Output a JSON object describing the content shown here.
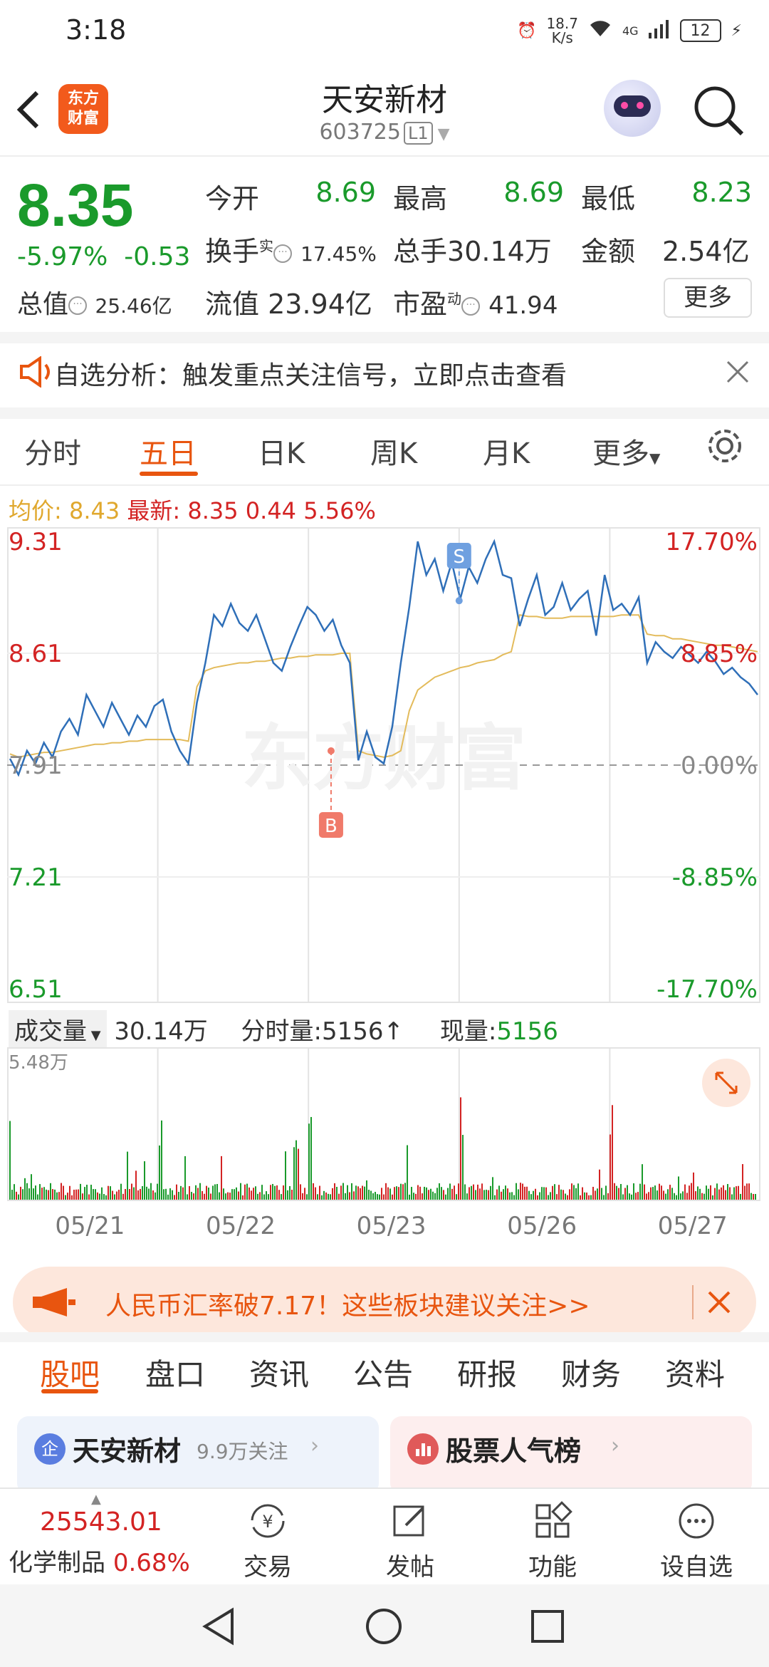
{
  "status_bar": {
    "time": "3:18",
    "net_speed_value": "18.7",
    "net_speed_unit": "K/s",
    "network": "4G",
    "battery": "12"
  },
  "header": {
    "logo_line1": "东方",
    "logo_line2": "财富",
    "title": "天安新材",
    "code": "603725",
    "level_badge": "L1"
  },
  "quote": {
    "price": "8.35",
    "change_pct": "-5.97%",
    "change_amt": "-0.53",
    "open_label": "今开",
    "open": "8.69",
    "high_label": "最高",
    "high": "8.69",
    "low_label": "最低",
    "low": "8.23",
    "turnover_label": "换手",
    "turnover_sup": "实",
    "turnover": "17.45%",
    "volume_label": "总手",
    "volume": "30.14万",
    "amount_label": "金额",
    "amount": "2.54亿",
    "total_cap_label": "总值",
    "total_cap": "25.46亿",
    "float_cap_label": "流值",
    "float_cap": "23.94亿",
    "pe_label": "市盈",
    "pe_sup": "动",
    "pe": "41.94",
    "more_button": "更多"
  },
  "notice": {
    "text": "自选分析：触发重点关注信号，立即点击查看"
  },
  "chart_tabs": [
    {
      "label": "分时",
      "active": false
    },
    {
      "label": "五日",
      "active": true
    },
    {
      "label": "日K",
      "active": false
    },
    {
      "label": "周K",
      "active": false
    },
    {
      "label": "月K",
      "active": false
    },
    {
      "label": "更多",
      "active": false
    }
  ],
  "legend": {
    "avg_label": "均价:",
    "avg": "8.43",
    "latest_label": "最新:",
    "latest": "8.35",
    "change": "0.44",
    "change_pct": "5.56%"
  },
  "volume_header": {
    "label": "成交量",
    "total": "30.14万",
    "interval_label": "分时量:",
    "interval_value": "5156",
    "current_label": "现量:",
    "current_value": "5156"
  },
  "banner": {
    "text": "人民币汇率破7.17！这些板块建议关注>>"
  },
  "bottom_tabs": [
    "股吧",
    "盘口",
    "资讯",
    "公告",
    "研报",
    "财务",
    "资料"
  ],
  "cards": {
    "left_title": "天安新材",
    "left_badge": "企",
    "left_follow": "9.9万关注",
    "right_title": "股票人气榜"
  },
  "bottom_bar": {
    "index_value": "25543.01",
    "index_name": "化学制品",
    "index_change": "0.68%",
    "items": [
      "交易",
      "发帖",
      "功能",
      "设自选"
    ]
  },
  "watermark": "东方财富",
  "chart_data": {
    "type": "line",
    "title": "",
    "x_categories": [
      "05/21",
      "05/22",
      "05/23",
      "05/26",
      "05/27"
    ],
    "y_ticks_price": [
      "9.31",
      "8.61",
      "7.91",
      "7.21",
      "6.51"
    ],
    "y_ticks_pct": [
      "17.70%",
      "8.85%",
      "0.00%",
      "-8.85%",
      "-17.70%"
    ],
    "ylim": [
      6.51,
      9.31
    ],
    "prev_close": 7.91,
    "grid": true,
    "series": [
      {
        "name": "",
        "values": [
          7.95,
          7.85,
          8.0,
          7.92,
          8.05,
          7.96,
          8.12,
          8.2,
          8.1,
          8.35,
          8.25,
          8.15,
          8.3,
          8.2,
          8.1,
          8.22,
          8.15,
          8.28,
          8.32,
          8.12,
          8.0,
          7.92,
          8.3,
          8.55,
          8.85,
          8.78,
          8.92,
          8.8,
          8.75,
          8.85,
          8.7,
          8.55,
          8.5,
          8.65,
          8.78,
          8.9,
          8.85,
          8.75,
          8.82,
          8.66,
          8.55,
          7.94,
          8.12,
          7.96,
          7.92,
          8.15,
          8.55,
          8.9,
          9.31,
          9.1,
          9.2,
          9.0,
          9.18,
          8.95,
          9.15,
          9.05,
          9.2,
          9.31,
          9.1,
          9.08,
          8.78,
          8.95,
          9.1,
          8.85,
          8.9,
          9.05,
          8.88,
          8.95,
          9.0,
          8.72,
          9.1,
          8.88,
          8.92,
          8.85,
          8.96,
          8.55,
          8.68,
          8.62,
          8.58,
          8.65,
          8.6,
          8.55,
          8.62,
          8.56,
          8.48,
          8.52,
          8.46,
          8.42,
          8.35
        ]
      },
      {
        "name": "",
        "values": [
          7.98,
          7.96,
          7.97,
          7.98,
          7.99,
          7.99,
          8.0,
          8.01,
          8.02,
          8.03,
          8.04,
          8.04,
          8.05,
          8.05,
          8.06,
          8.06,
          8.07,
          8.07,
          8.07,
          8.07,
          8.07,
          8.06,
          8.4,
          8.5,
          8.52,
          8.53,
          8.54,
          8.55,
          8.55,
          8.56,
          8.56,
          8.57,
          8.58,
          8.58,
          8.59,
          8.59,
          8.6,
          8.6,
          8.6,
          8.61,
          8.61,
          8.0,
          7.98,
          7.97,
          7.96,
          7.97,
          8.0,
          8.25,
          8.38,
          8.42,
          8.46,
          8.48,
          8.5,
          8.52,
          8.53,
          8.55,
          8.56,
          8.57,
          8.6,
          8.62,
          8.85,
          8.84,
          8.84,
          8.83,
          8.83,
          8.83,
          8.84,
          8.84,
          8.84,
          8.84,
          8.84,
          8.84,
          8.85,
          8.85,
          8.85,
          8.73,
          8.72,
          8.72,
          8.7,
          8.7,
          8.69,
          8.68,
          8.67,
          8.66,
          8.66,
          8.65,
          8.64,
          8.63,
          8.62
        ]
      }
    ],
    "trade_marks": [
      {
        "label": "B",
        "day": "05/23"
      },
      {
        "label": "S",
        "day": "05/23"
      }
    ],
    "volume": {
      "max_label": "5.48万"
    }
  }
}
